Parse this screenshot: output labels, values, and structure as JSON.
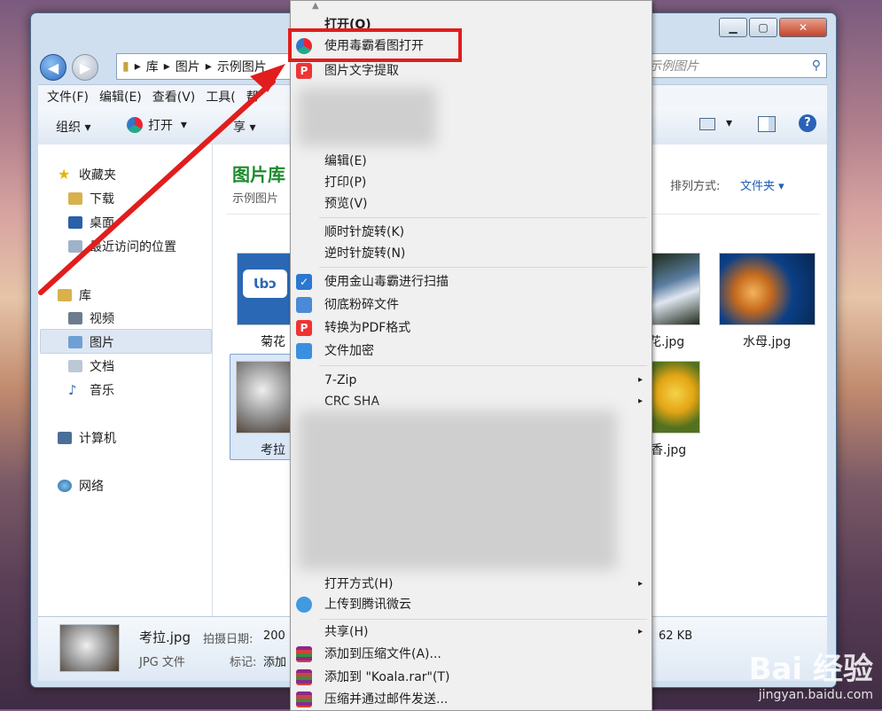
{
  "window": {
    "nav": {
      "back_icon": "back-arrow-icon",
      "forward_icon": "forward-arrow-icon"
    },
    "breadcrumb": [
      "库",
      "图片",
      "示例图片"
    ],
    "search_placeholder": "示例图片",
    "menu": [
      "文件(F)",
      "编辑(E)",
      "查看(V)",
      "工具(",
      "帮"
    ],
    "toolbar": {
      "organize": "组织",
      "open": "打开",
      "share": "享"
    },
    "sidebar": {
      "favorites": "收藏夹",
      "downloads": "下载",
      "desktop": "桌面",
      "recent": "最近访问的位置",
      "libraries": "库",
      "videos": "视频",
      "pictures": "图片",
      "documents": "文档",
      "music": "音乐",
      "computer": "计算机",
      "network": "网络"
    },
    "content": {
      "title": "图片库",
      "subtitle": "示例图片",
      "sort_label": "排列方式:",
      "sort_value": "文件夹",
      "files": [
        "菊花",
        "考拉",
        "花.jpg",
        "水母.jpg",
        "香.jpg"
      ]
    },
    "details": {
      "filename": "考拉.jpg",
      "date_label": "拍摄日期:",
      "date_value": "200",
      "type": "JPG 文件",
      "tag_label": "标记:",
      "tag_value": "添加",
      "size": "62 KB"
    }
  },
  "context_menu": {
    "open": "打开(O)",
    "open_with_viewer": "使用毒霸看图打开",
    "extract_text": "图片文字提取",
    "edit": "编辑(E)",
    "print": "打印(P)",
    "preview": "预览(V)",
    "rotate_cw": "顺时针旋转(K)",
    "rotate_ccw": "逆时针旋转(N)",
    "scan": "使用金山毒霸进行扫描",
    "shred": "彻底粉碎文件",
    "to_pdf": "转换为PDF格式",
    "encrypt": "文件加密",
    "zip7": "7-Zip",
    "crc": "CRC SHA",
    "open_with": "打开方式(H)",
    "upload": "上传到腾讯微云",
    "share": "共享(H)",
    "add_archive": "添加到压缩文件(A)...",
    "add_rar": "添加到 \"Koala.rar\"(T)",
    "compress_email": "压缩并通过邮件发送..."
  },
  "watermark": {
    "brand": "Bai 经验",
    "site": "jingyan.baidu.com"
  },
  "colors": {
    "highlight": "#e11d1d",
    "title_green": "#1e8a2e",
    "link_blue": "#1e5fb4"
  }
}
